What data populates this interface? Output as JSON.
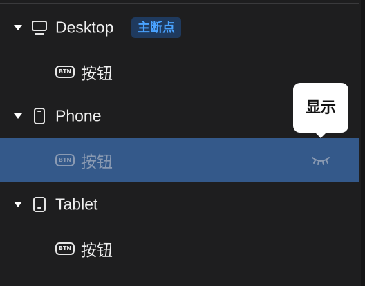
{
  "tree": {
    "groups": [
      {
        "device": "Desktop",
        "icon": "desktop-icon",
        "badge": "主断点",
        "children": [
          {
            "label": "按钮",
            "icon_text": "BTN",
            "selected": false
          }
        ]
      },
      {
        "device": "Phone",
        "icon": "phone-icon",
        "children": [
          {
            "label": "按钮",
            "icon_text": "BTN",
            "selected": true,
            "visibility_icon": "eye-closed-icon"
          }
        ]
      },
      {
        "device": "Tablet",
        "icon": "tablet-icon",
        "children": [
          {
            "label": "按钮",
            "icon_text": "BTN",
            "selected": false
          }
        ]
      }
    ]
  },
  "tooltip": {
    "text": "显示"
  },
  "colors": {
    "background": "#1e1e1f",
    "selected_row": "#34598a",
    "badge_bg": "#1f3a5e",
    "badge_text": "#4aa3ff",
    "tooltip_bg": "#ffffff"
  }
}
